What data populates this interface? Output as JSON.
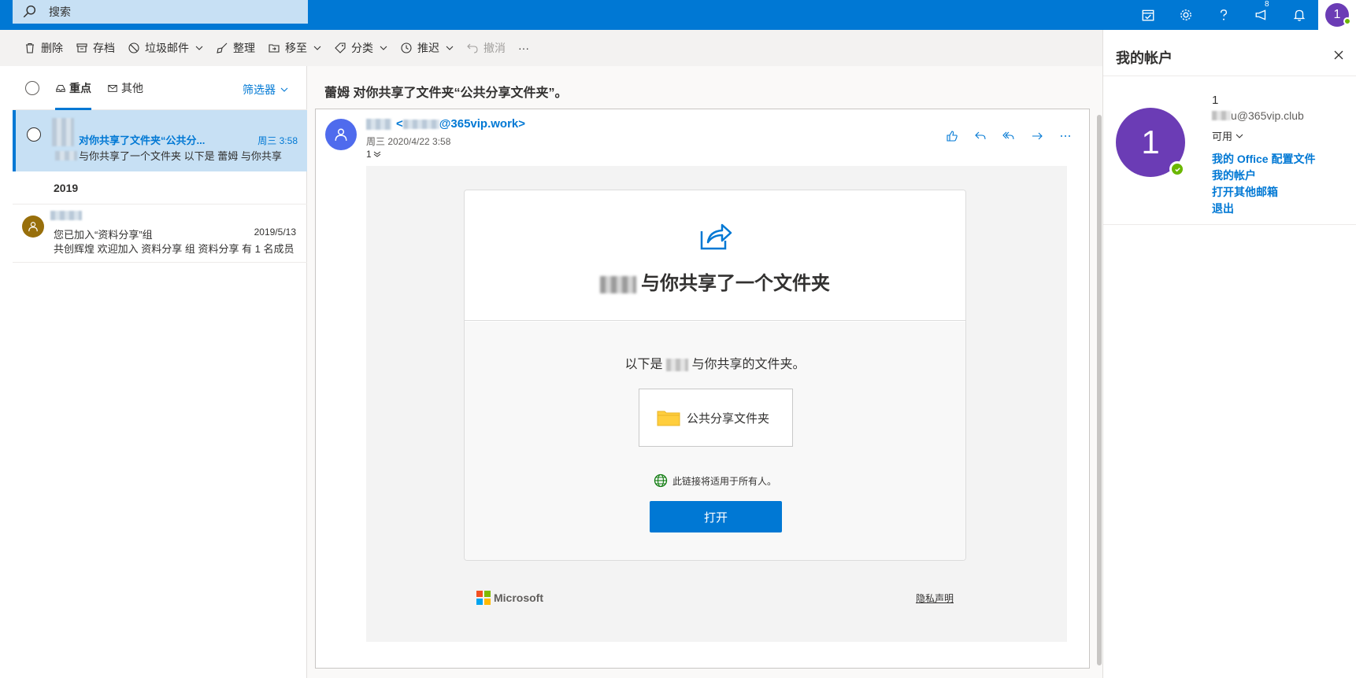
{
  "search": {
    "placeholder": "搜索"
  },
  "topbar": {
    "notification_count": "8",
    "avatar_initial": "1"
  },
  "commands": {
    "delete": "删除",
    "archive": "存档",
    "junk": "垃圾邮件",
    "sweep": "整理",
    "move": "移至",
    "categorize": "分类",
    "snooze": "推迟",
    "undo": "撤消",
    "more": "···"
  },
  "list": {
    "tab_focused": "重点",
    "tab_other": "其他",
    "filter": "筛选器",
    "messages": [
      {
        "subject": "对你共享了文件夹“公共分...",
        "time": "周三 3:58",
        "preview": "与你共享了一个文件夹 以下是 蕾姆 与你共享"
      }
    ],
    "group_label": "2019",
    "messages2019": [
      {
        "subject": "您已加入“资料分享”组",
        "time": "2019/5/13",
        "preview": "共创辉煌 欢迎加入 资料分享 组 资料分享 有 1 名成员"
      }
    ]
  },
  "reading": {
    "title": "蕾姆 对你共享了文件夹“公共分享文件夹”。",
    "from_email": "@365vip.work>",
    "date": "周三 2020/4/22 3:58",
    "recipients": "1",
    "card": {
      "headline": "与你共享了一个文件夹",
      "intro_prefix": "以下是",
      "intro_suffix": "与你共享的文件夹。",
      "folder_name": "公共分享文件夹",
      "link_note": "此链接将适用于所有人。",
      "open_button": "打开"
    },
    "footer": {
      "brand": "Microsoft",
      "privacy": "隐私声明"
    }
  },
  "account": {
    "title": "我的帐户",
    "name": "1",
    "email": "u@365vip.club",
    "status": "可用",
    "avatar_initial": "1",
    "links": [
      "我的 Office 配置文件",
      "我的帐户",
      "打开其他邮箱",
      "退出"
    ]
  },
  "colors": {
    "brand": "#0078d4",
    "avatar": "#6b3cb5",
    "presence": "#6bb700",
    "selected_row": "#c7e0f4"
  }
}
